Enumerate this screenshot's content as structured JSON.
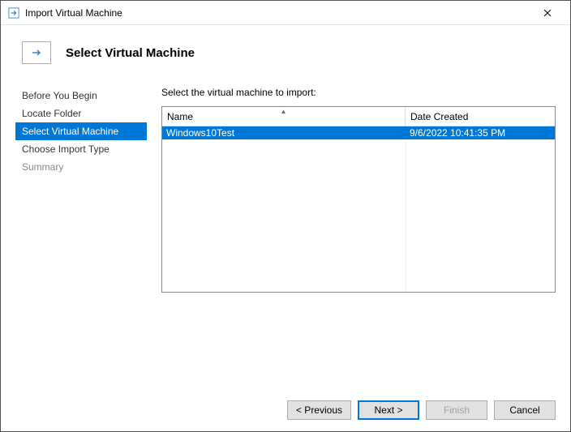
{
  "window": {
    "title": "Import Virtual Machine"
  },
  "header": {
    "page_title": "Select Virtual Machine"
  },
  "sidebar": {
    "items": [
      {
        "label": "Before You Begin",
        "state": "normal"
      },
      {
        "label": "Locate Folder",
        "state": "normal"
      },
      {
        "label": "Select Virtual Machine",
        "state": "selected"
      },
      {
        "label": "Choose Import Type",
        "state": "normal"
      },
      {
        "label": "Summary",
        "state": "disabled"
      }
    ]
  },
  "main": {
    "instruction": "Select the virtual machine to import:",
    "columns": {
      "name": "Name",
      "date": "Date Created"
    },
    "rows": [
      {
        "name": "Windows10Test",
        "date": "9/6/2022 10:41:35 PM",
        "selected": true
      }
    ]
  },
  "footer": {
    "previous": "< Previous",
    "next": "Next >",
    "finish": "Finish",
    "cancel": "Cancel"
  },
  "colors": {
    "accent": "#0078d7"
  }
}
